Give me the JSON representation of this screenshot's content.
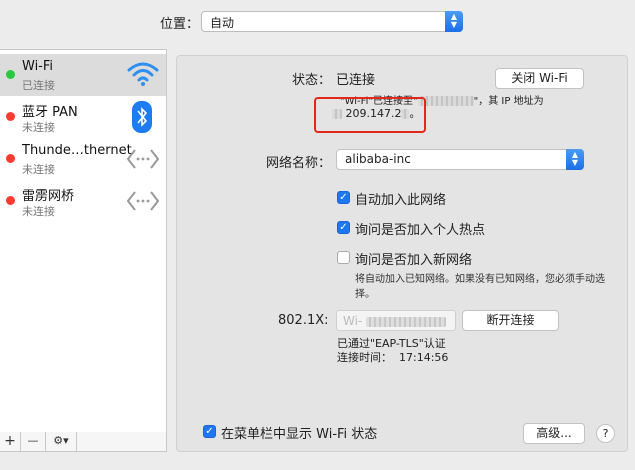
{
  "location": {
    "label": "位置：",
    "value": "自动"
  },
  "sidebar": {
    "services": [
      {
        "name": "Wi-Fi",
        "status": "已连接",
        "dot_color": "#27c93f",
        "icon": "wifi-icon"
      },
      {
        "name": "蓝牙 PAN",
        "status": "未连接",
        "dot_color": "#ff3b30",
        "icon": "bluetooth-icon"
      },
      {
        "name": "Thunde…thernet",
        "status": "未连接",
        "dot_color": "#ff3b30",
        "icon": "ethernet-arrows-icon"
      },
      {
        "name": "雷雳网桥",
        "status": "未连接",
        "dot_color": "#ff3b30",
        "icon": "ethernet-arrows-icon"
      }
    ],
    "tools": {
      "add": "+",
      "remove": "—",
      "action": "⚙▾"
    }
  },
  "status": {
    "label": "状态：",
    "value": "已连接",
    "description_line1_a": "\"Wi-Fi\"已连接至\"",
    "description_line1_b": "\"，其 IP 地址为",
    "ip_partial": "209.147.2",
    "ip_end": "。",
    "toggle_wifi_button": "关闭 Wi-Fi"
  },
  "network": {
    "label": "网络名称：",
    "value": "alibaba-inc"
  },
  "options": [
    {
      "label": "自动加入此网络",
      "checked": true
    },
    {
      "label": "询问是否加入个人热点",
      "checked": true
    },
    {
      "label": "询问是否加入新网络",
      "checked": false
    }
  ],
  "ask_note": "将自动加入已知网络。如果没有已知网络，您必须手动选择。",
  "dot1x": {
    "label": "802.1X:",
    "profile_prefix": "Wi-",
    "disconnect_button": "断开连接",
    "auth_text": "已通过\"EAP-TLS\"认证",
    "connect_time": "连接时间：  17:14:56"
  },
  "menubar_option": {
    "label": "在菜单栏中显示 Wi-Fi 状态",
    "checked": true
  },
  "advanced_button": "高级...",
  "help_button": "?",
  "accent_color": "#1f77f0",
  "highlight_color": "#e0281c"
}
